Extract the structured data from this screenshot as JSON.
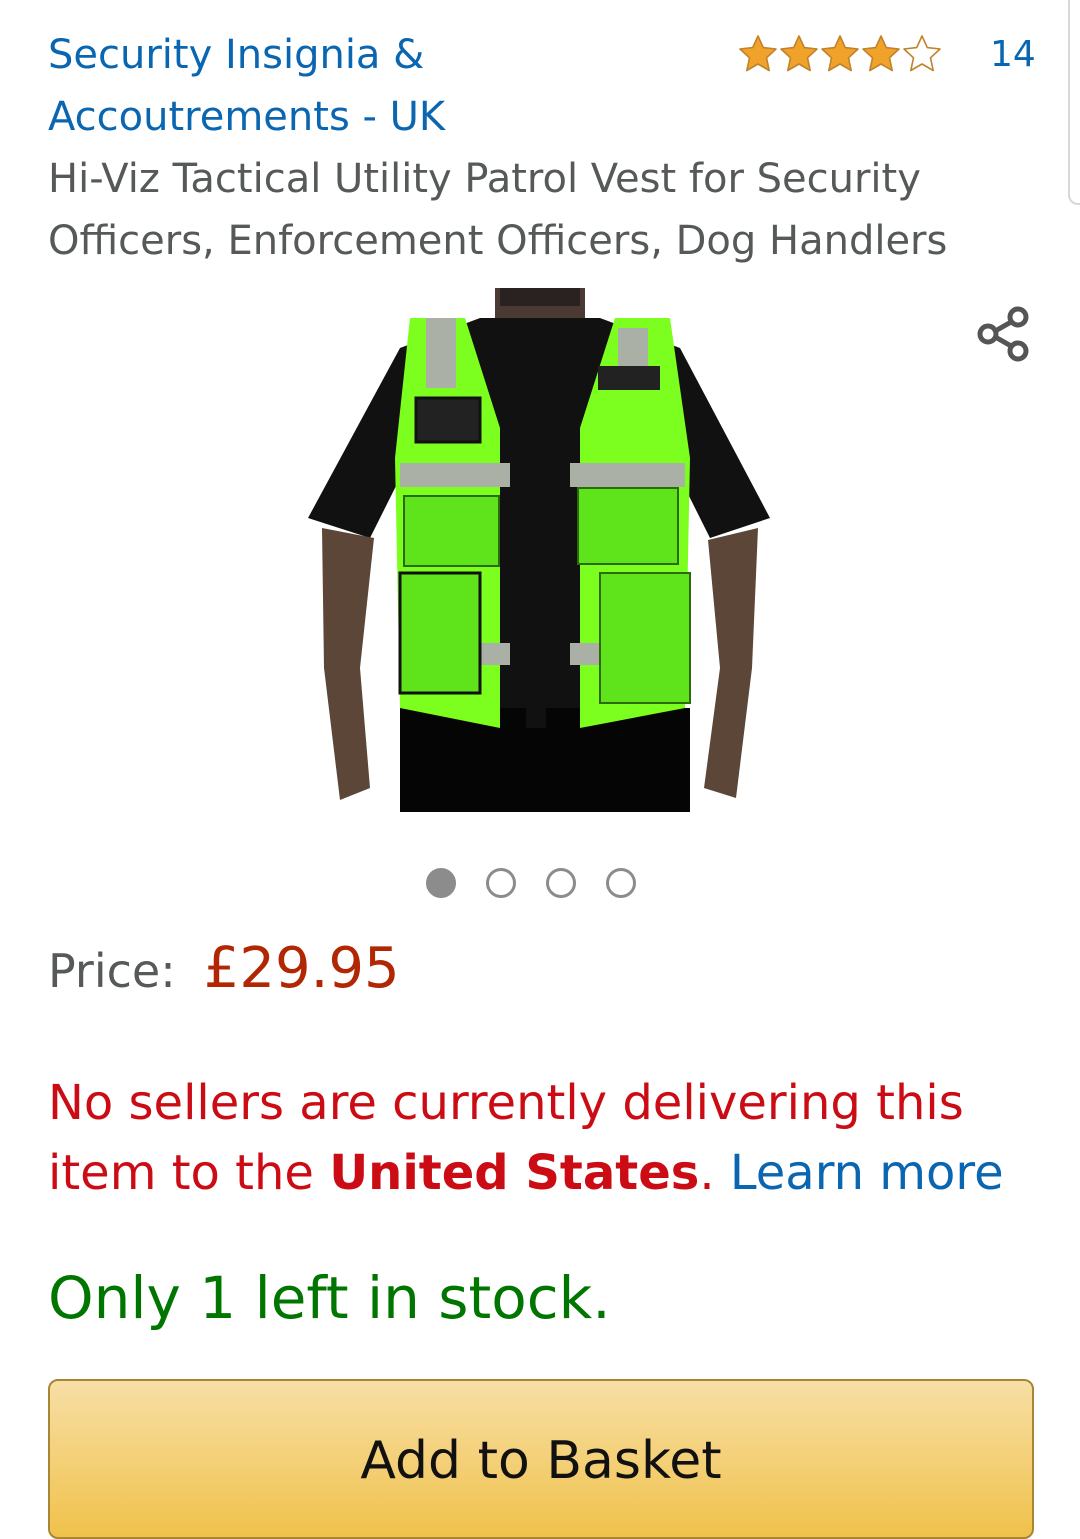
{
  "brand": {
    "name": "Security Insignia & Accoutrements - UK"
  },
  "rating": {
    "stars": 4.5,
    "max": 5,
    "count": "14",
    "icon": "star-rating-icon",
    "color": "#f1a22a"
  },
  "product": {
    "title": "Hi-Viz Tactical Utility Patrol Vest for Security Officers, Enforcement Officers, Dog Handlers",
    "image_alt": "Hi-viz green tactical patrol vest",
    "share_icon": "share-icon"
  },
  "carousel": {
    "count": 4,
    "active": 1
  },
  "price": {
    "label": "Price:",
    "value": "£29.95",
    "color": "#b12704"
  },
  "delivery": {
    "prefix": "No sellers are currently delivering this item to the ",
    "country": "United States",
    "suffix": ". ",
    "link": "Learn more"
  },
  "stock": {
    "text": "Only 1 left in stock.",
    "color": "#007600"
  },
  "actions": {
    "add_to_basket": "Add to Basket"
  }
}
